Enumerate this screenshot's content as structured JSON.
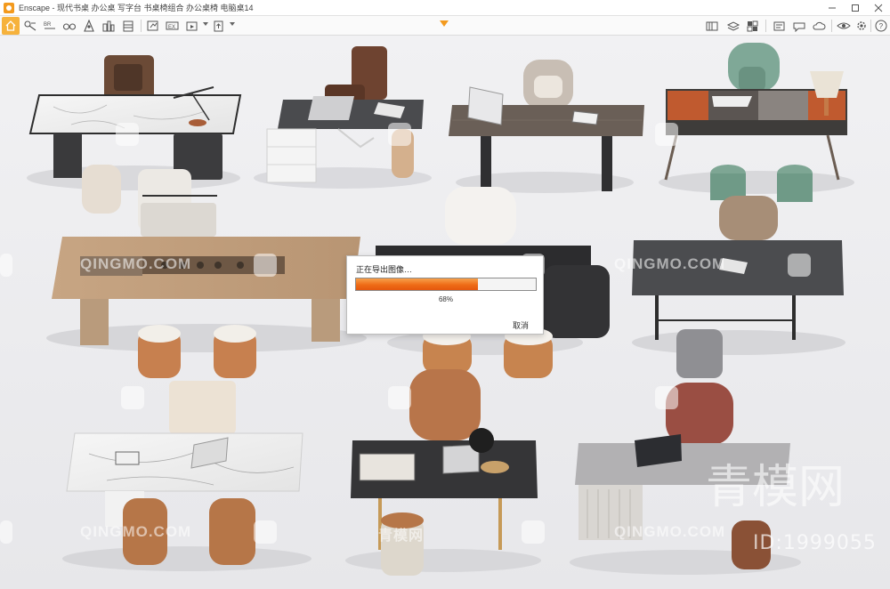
{
  "window": {
    "title": "Enscape - 现代书桌 办公桌 写字台 书桌椅组合 办公桌椅 电脑桌14",
    "app_name": "Enscape",
    "accent_color": "#f39a1e"
  },
  "toolbar": {
    "icons": [
      "home-icon",
      "screenshot-icon",
      "batch-render-icon",
      "binoculars-icon",
      "walk-mode-icon",
      "asset-library-icon",
      "book-icon",
      "export-icon",
      "panorama-icon",
      "video-editor-icon",
      "view-management-icon",
      "upload-icon",
      "settings-icon",
      "visual-settings-icon",
      "feedback-icon",
      "help-icon"
    ]
  },
  "export_dialog": {
    "title": "正在导出图像…",
    "progress": 0.68,
    "progress_text": "68%",
    "cancel_label": "取消",
    "fill_color": "#ef6c17"
  },
  "watermarks": {
    "site": "QINGMO.COM",
    "brand_cn": "青模网",
    "brand_cn_large": "青模网",
    "id_text": "ID:1999055"
  }
}
